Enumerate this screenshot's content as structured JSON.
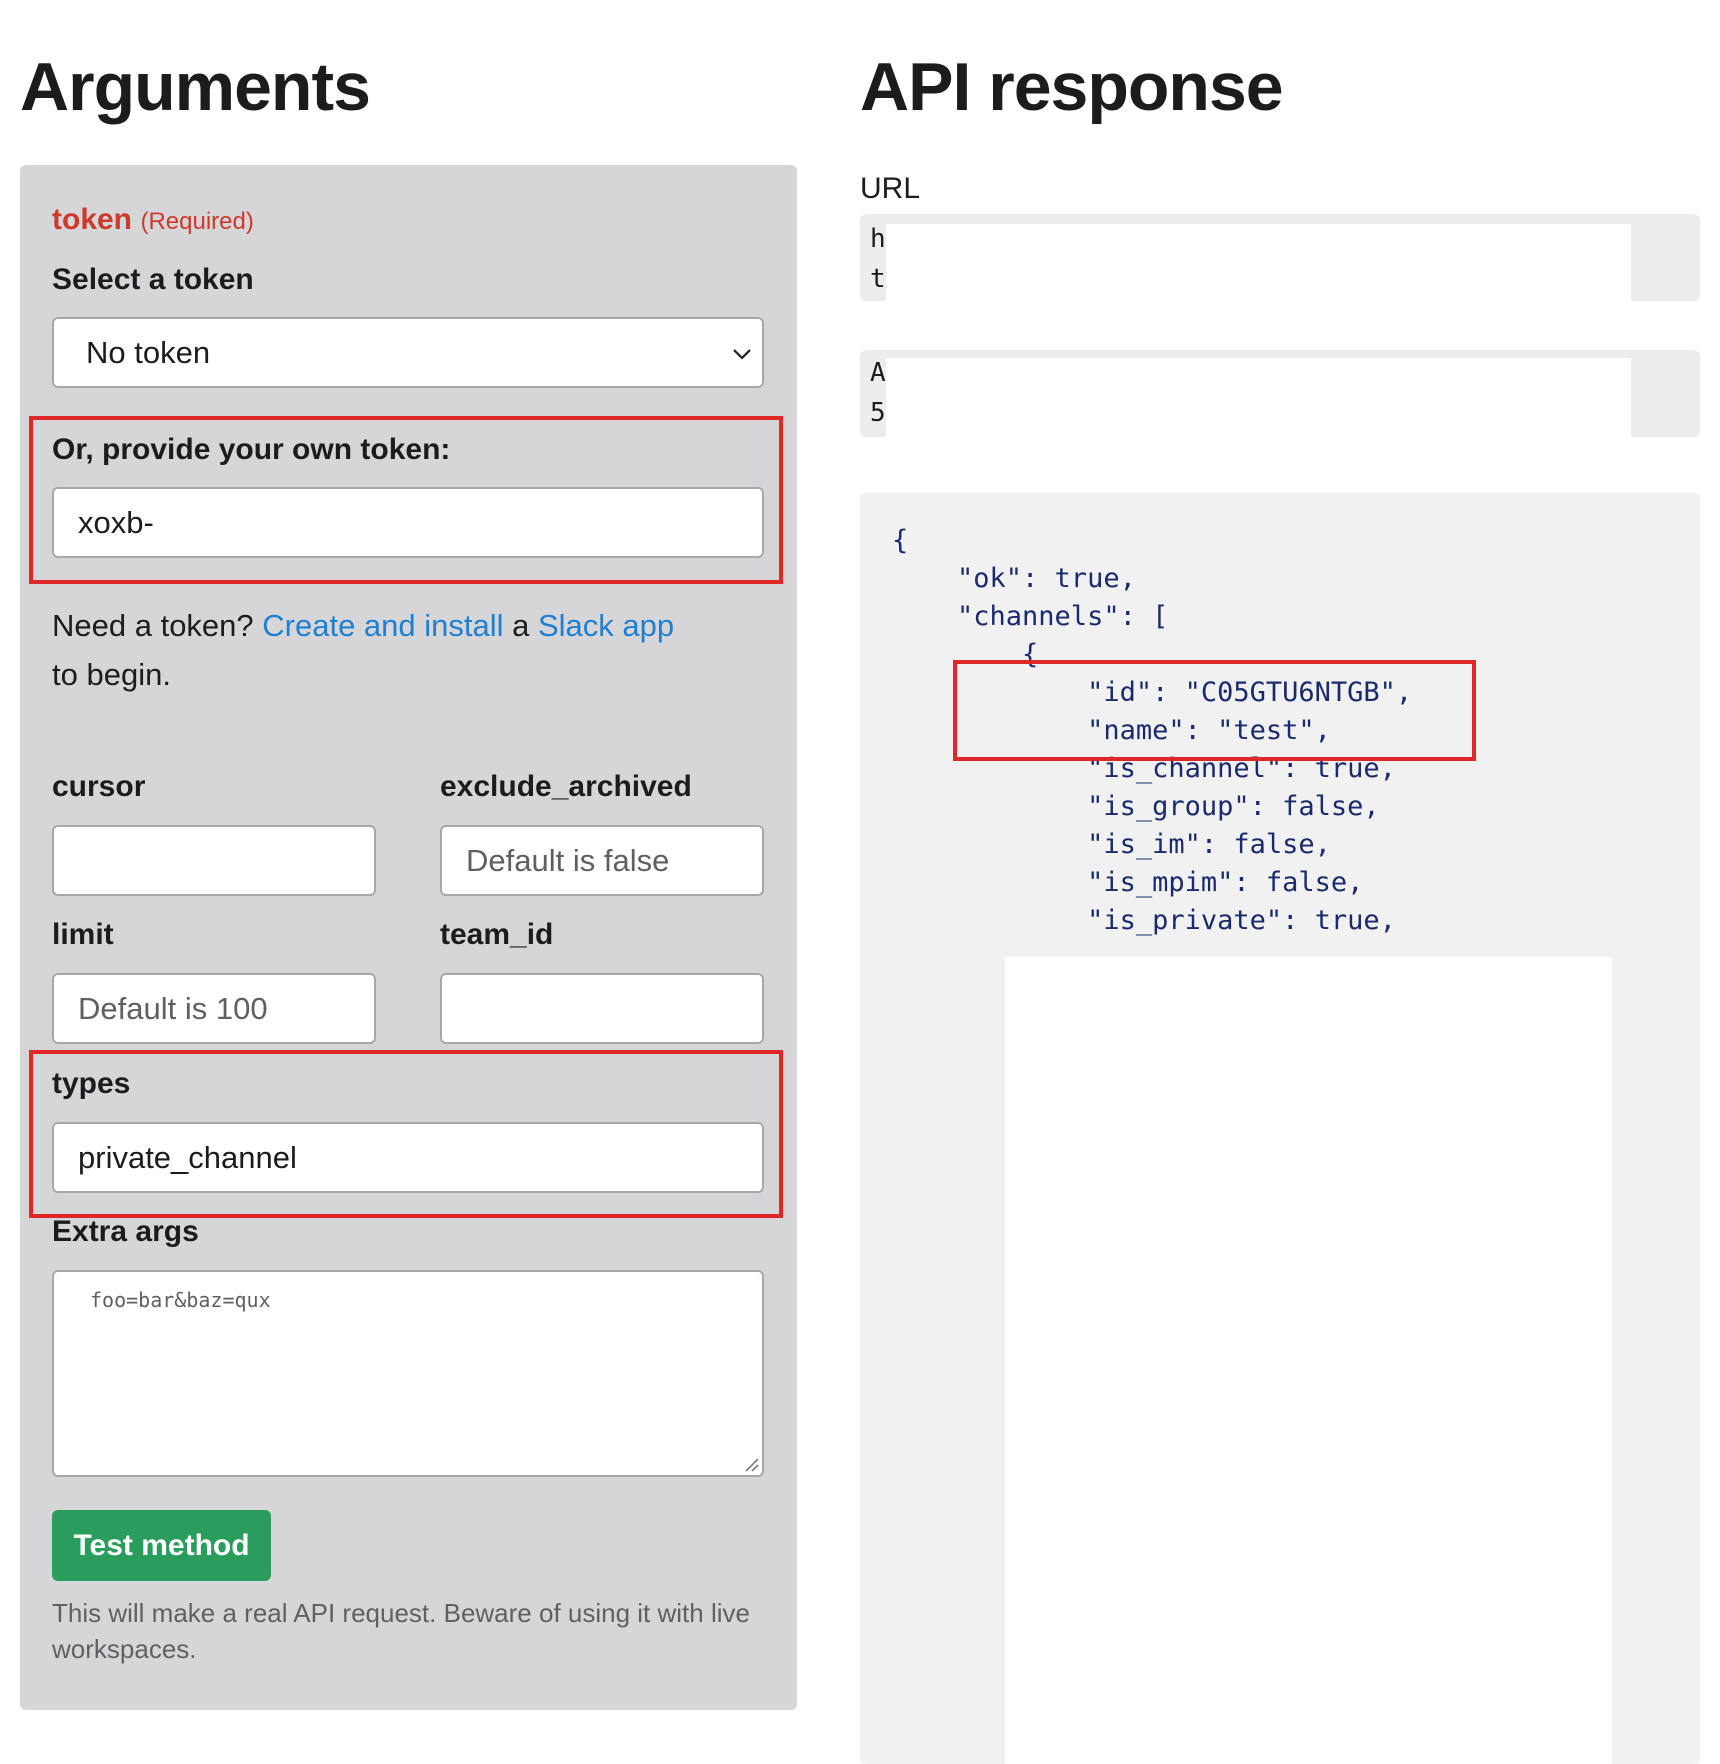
{
  "left": {
    "heading": "Arguments",
    "token": {
      "name": "token",
      "required": "(Required)",
      "select_label": "Select a token",
      "select_value": "No token",
      "own_label": "Or, provide your own token:",
      "own_value": "xoxb-",
      "help_prefix": "Need a token? ",
      "help_link1": "Create and install",
      "help_mid": " a ",
      "help_link2": "Slack app",
      "help_suffix": " to begin."
    },
    "fields": {
      "cursor_label": "cursor",
      "cursor_value": "",
      "exclude_archived_label": "exclude_archived",
      "exclude_archived_placeholder": "Default is false",
      "limit_label": "limit",
      "limit_placeholder": "Default is 100",
      "team_id_label": "team_id",
      "team_id_value": "",
      "types_label": "types",
      "types_value": "private_channel",
      "extra_label": "Extra args",
      "extra_placeholder": "foo=bar&baz=qux"
    },
    "test_button": "Test method",
    "warning": "This will make a real API request. Beware of using it with live workspaces."
  },
  "right": {
    "heading": "API response",
    "url_label": "URL",
    "url_chars": [
      "h",
      "t"
    ],
    "auth_chars": [
      "A",
      "5"
    ],
    "json_lines": [
      "{",
      "    \"ok\": true,",
      "    \"channels\": [",
      "        {",
      "            \"id\": \"C05GTU6NTGB\",",
      "            \"name\": \"test\",",
      "            \"is_channel\": true,",
      "            \"is_group\": false,",
      "            \"is_im\": false,",
      "            \"is_mpim\": false,",
      "            \"is_private\": true,"
    ]
  },
  "colors": {
    "required_red": "#cc3a2b",
    "link_blue": "#1f7fd0",
    "button_green": "#2a9d5c",
    "highlight_red": "#e02727",
    "json_text": "#1a2a6c"
  }
}
